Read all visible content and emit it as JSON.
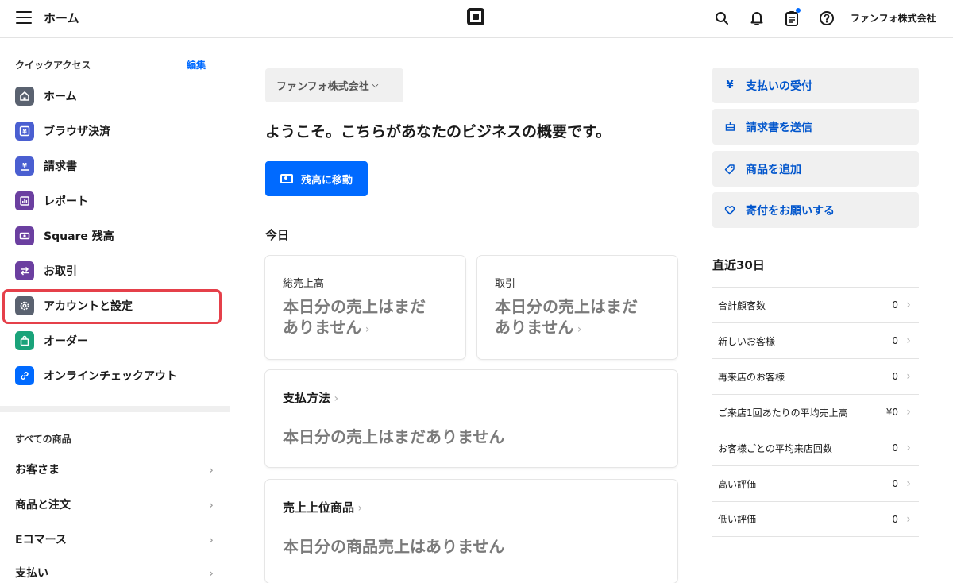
{
  "topbar": {
    "title": "ホーム",
    "company": "ファンフォ株式会社"
  },
  "sidebar": {
    "quick_access_heading": "クイックアクセス",
    "edit_label": "編集",
    "quick_items": [
      {
        "label": "ホーム",
        "icon": "home-icon",
        "color": "#5a6270"
      },
      {
        "label": "ブラウザ決済",
        "icon": "yen-icon",
        "color": "#4a5fd1"
      },
      {
        "label": "請求書",
        "icon": "invoice-icon",
        "color": "#4a5fd1"
      },
      {
        "label": "レポート",
        "icon": "chart-icon",
        "color": "#6b3fa0"
      },
      {
        "label": "Square 残高",
        "icon": "money-icon",
        "color": "#6b3fa0"
      },
      {
        "label": "お取引",
        "icon": "transfer-icon",
        "color": "#6b3fa0"
      },
      {
        "label": "アカウントと設定",
        "icon": "gear-icon",
        "color": "#5a6270"
      },
      {
        "label": "オーダー",
        "icon": "bag-icon",
        "color": "#1aa37a"
      },
      {
        "label": "オンラインチェックアウト",
        "icon": "link-icon",
        "color": "#006aff"
      }
    ],
    "all_items_heading": "すべての商品",
    "nav_items": [
      {
        "label": "お客さま"
      },
      {
        "label": "商品と注文"
      },
      {
        "label": "Eコマース"
      },
      {
        "label": "支払い"
      }
    ]
  },
  "main": {
    "business_select": "ファンフォ株式会社",
    "welcome": "ようこそ。こちらがあなたのビジネスの概要です。",
    "balance_button": "残高に移動",
    "today_heading": "今日",
    "gross_sales_title": "総売上高",
    "gross_sales_line1": "本日分の売上はまだ",
    "gross_sales_line2": "ありません",
    "transactions_title": "取引",
    "transactions_line1": "本日分の売上はまだ",
    "transactions_line2": "ありません",
    "payment_methods_title": "支払方法",
    "payment_methods_body": "本日分の売上はまだありません",
    "top_items_title": "売上上位商品",
    "top_items_body": "本日分の商品売上はありません"
  },
  "right": {
    "actions": [
      {
        "label": "支払いの受付",
        "icon": "yen-icon"
      },
      {
        "label": "請求書を送信",
        "icon": "invoice-icon"
      },
      {
        "label": "商品を追加",
        "icon": "tag-icon"
      },
      {
        "label": "寄付をお願いする",
        "icon": "heart-icon"
      }
    ],
    "period_title": "直近30日",
    "stats": [
      {
        "label": "合計顧客数",
        "value": "0"
      },
      {
        "label": "新しいお客様",
        "value": "0"
      },
      {
        "label": "再来店のお客様",
        "value": "0"
      },
      {
        "label": "ご来店1回あたりの平均売上高",
        "value": "¥0"
      },
      {
        "label": "お客様ごとの平均来店回数",
        "value": "0"
      },
      {
        "label": "高い評価",
        "value": "0"
      },
      {
        "label": "低い評価",
        "value": "0"
      }
    ]
  },
  "colors": {
    "accent": "#006aff",
    "highlight_border": "#e5404a"
  }
}
